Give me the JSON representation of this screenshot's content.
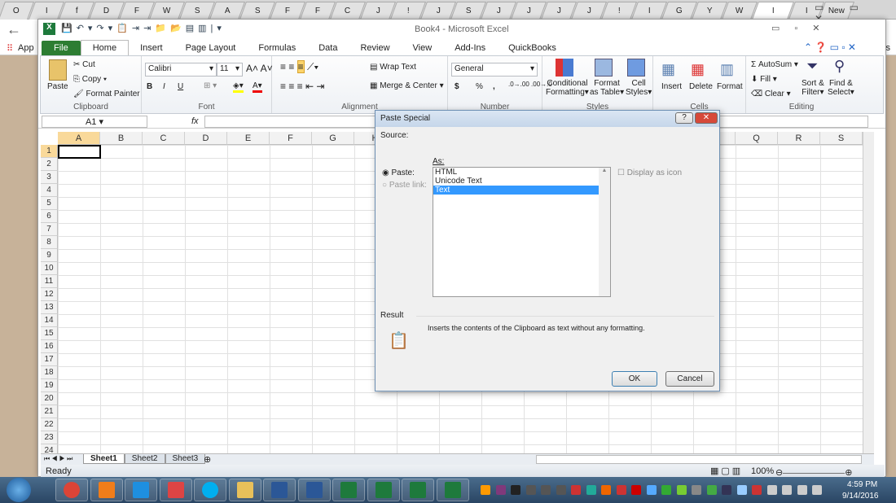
{
  "browser": {
    "tabs": [
      "O",
      "I",
      "f",
      "D",
      "F",
      "W",
      "S",
      "A",
      "S",
      "F",
      "F",
      "C",
      "J",
      "!",
      "J",
      "S",
      "J",
      "J",
      "J",
      "J",
      "!",
      "I",
      "G",
      "Y",
      "W",
      "I",
      "I",
      "New"
    ],
    "active_tab": "I",
    "apps_label": "App",
    "right_label": "ks"
  },
  "excel": {
    "title": "Book4  -  Microsoft Excel",
    "tabs": [
      "File",
      "Home",
      "Insert",
      "Page Layout",
      "Formulas",
      "Data",
      "Review",
      "View",
      "Add-Ins",
      "QuickBooks"
    ],
    "clipboard": {
      "paste": "Paste",
      "cut": "Cut",
      "copy": "Copy",
      "format_painter": "Format Painter",
      "label": "Clipboard"
    },
    "font": {
      "name": "Calibri",
      "size": "11",
      "bold": "B",
      "italic": "I",
      "underline": "U",
      "label": "Font"
    },
    "alignment": {
      "wrap": "Wrap Text",
      "merge": "Merge & Center",
      "label": "Alignment"
    },
    "number": {
      "format": "General",
      "currency": "$",
      "percent": "%",
      "comma": ",",
      "label": "Number"
    },
    "styles": {
      "conditional": "Conditional",
      "conditional2": "Formatting",
      "format_table": "Format",
      "format_table2": "as Table",
      "cell_styles": "Cell",
      "cell_styles2": "Styles",
      "label": "Styles"
    },
    "cells": {
      "insert": "Insert",
      "delete": "Delete",
      "format": "Format",
      "label": "Cells"
    },
    "editing": {
      "autosum": "AutoSum",
      "fill": "Fill",
      "clear": "Clear",
      "sort": "Sort &",
      "sort2": "Filter",
      "find": "Find &",
      "find2": "Select",
      "label": "Editing"
    },
    "name_box": "A1",
    "fx": "fx",
    "columns": [
      "A",
      "B",
      "C",
      "D",
      "E",
      "F",
      "G",
      "H",
      "I",
      "J",
      "K",
      "L",
      "M",
      "N",
      "O",
      "P",
      "Q",
      "R",
      "S"
    ],
    "rows": [
      "1",
      "2",
      "3",
      "4",
      "5",
      "6",
      "7",
      "8",
      "9",
      "10",
      "11",
      "12",
      "13",
      "14",
      "15",
      "16",
      "17",
      "18",
      "19",
      "20",
      "21",
      "22",
      "23",
      "24"
    ],
    "sheets": [
      "Sheet1",
      "Sheet2",
      "Sheet3"
    ],
    "status": "Ready",
    "zoom": "100%"
  },
  "dialog": {
    "title": "Paste Special",
    "source_label": "Source:",
    "as_label": "As:",
    "paste_radio": "Paste:",
    "paste_link_radio": "Paste link:",
    "options": [
      "HTML",
      "Unicode Text",
      "Text"
    ],
    "selected": "Text",
    "display_icon": "Display as icon",
    "result_label": "Result",
    "result_text": "Inserts the contents of the Clipboard as text without any formatting.",
    "ok": "OK",
    "cancel": "Cancel",
    "help": "?",
    "close": "✕"
  },
  "taskbar": {
    "time": "4:59 PM",
    "date": "9/14/2016",
    "apps": [
      "chrome",
      "media",
      "ie",
      "snipping",
      "skype",
      "explorer",
      "word",
      "word",
      "excel",
      "excel",
      "excel",
      "excel"
    ]
  },
  "colors": {
    "file_tab": "#2d7d32",
    "selection": "#3399ff",
    "taskbar": "#2a4563"
  }
}
